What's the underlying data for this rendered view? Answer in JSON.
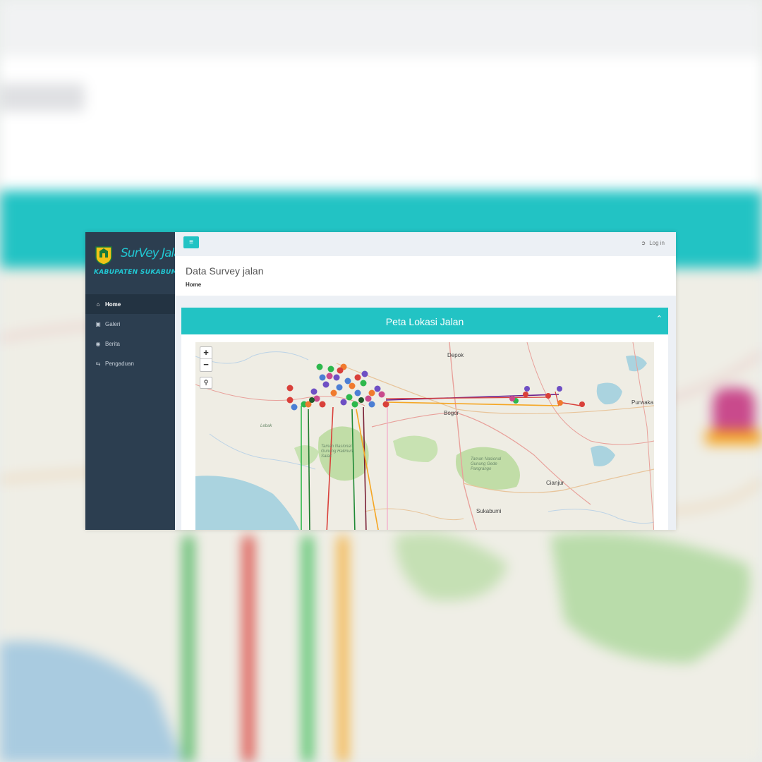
{
  "app": {
    "logo_title": "SurVey Jalan",
    "logo_subtitle": "KABUPATEN SUKABUMI"
  },
  "sidebar": {
    "items": [
      {
        "label": "Home",
        "icon": "home-icon",
        "active": true
      },
      {
        "label": "Galeri",
        "icon": "camera-icon",
        "active": false
      },
      {
        "label": "Berita",
        "icon": "eye-icon",
        "active": false
      },
      {
        "label": "Pengaduan",
        "icon": "exchange-icon",
        "active": false
      }
    ]
  },
  "topbar": {
    "toggle_icon": "menu-icon",
    "login_label": "Log in",
    "login_icon": "sign-in-icon"
  },
  "header": {
    "title": "Data Survey jalan",
    "breadcrumb": "Home"
  },
  "map_box": {
    "title": "Peta Lokasi Jalan",
    "collapse_icon": "chevron-up-icon",
    "zoom_in": "+",
    "zoom_out": "−",
    "search_icon": "search-icon",
    "places": {
      "depok": "Depok",
      "bogor": "Bogor",
      "purwakarta": "Purwaka",
      "cianjur": "Cianjur",
      "sukabumi": "Sukabumi",
      "lebak": "Lebak",
      "park1": "Taman Nasional Gunung Halimun Salak",
      "park2": "Taman Nasional Gunung Gede Pangrango"
    }
  },
  "colors": {
    "accent": "#22c3c4",
    "sidebar": "#2c3e50",
    "marker_green": "#2db84c",
    "marker_purple": "#6e4fc4",
    "marker_orange": "#f07a2e",
    "marker_red": "#d9403a",
    "marker_pink": "#c94a8c",
    "marker_blue": "#4c7fd4"
  }
}
